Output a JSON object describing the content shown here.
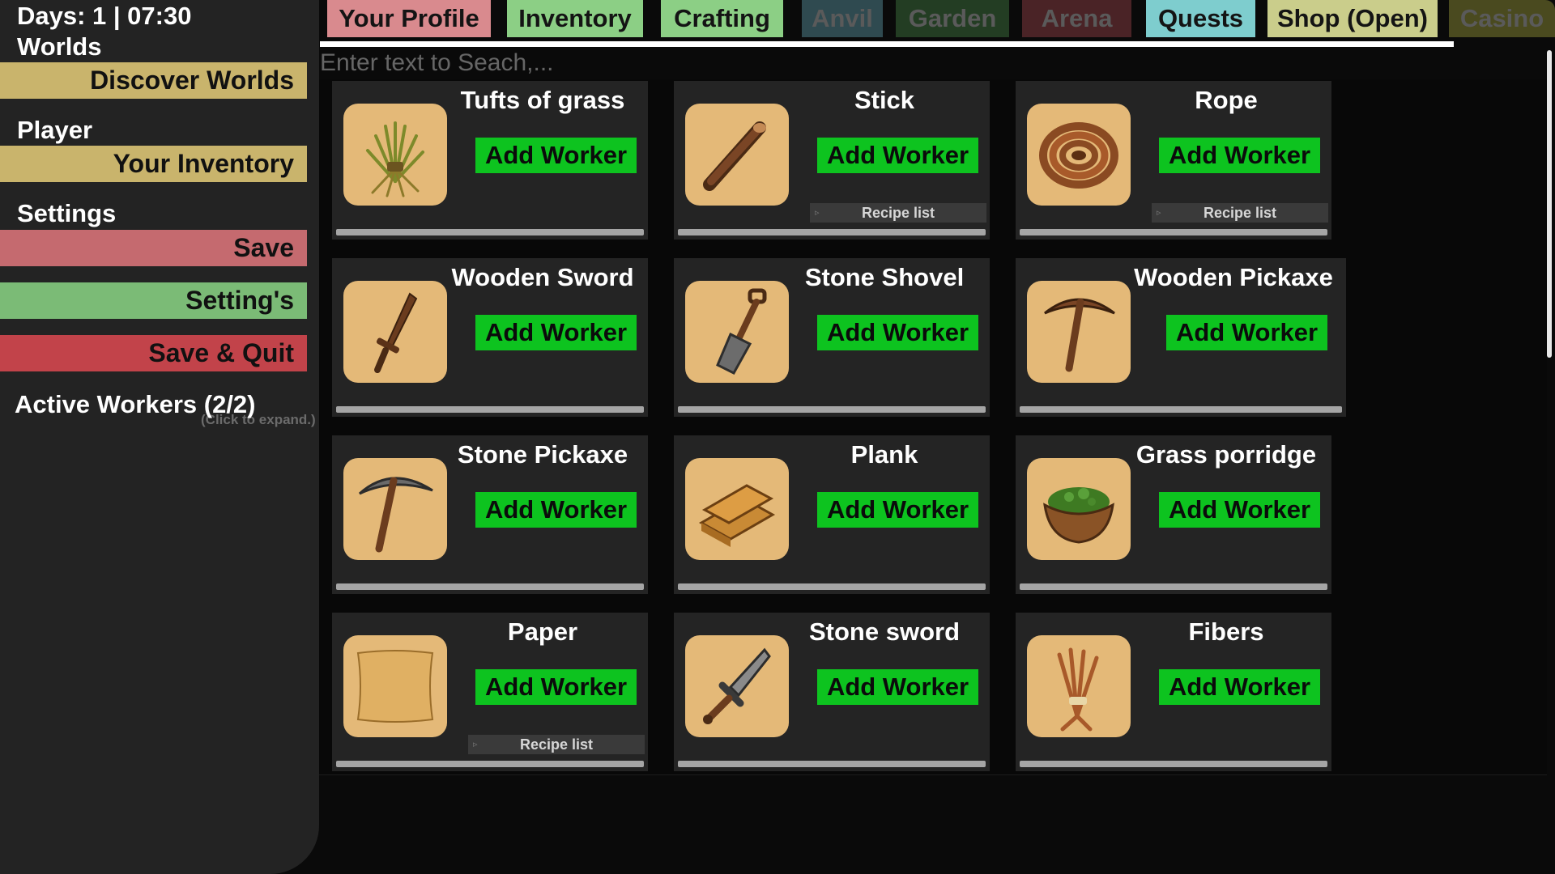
{
  "sidebar": {
    "days_clock": "Days: 1 | 07:30",
    "worlds_label": "Worlds",
    "discover_worlds": "Discover Worlds",
    "player_label": "Player",
    "your_inventory": "Your Inventory",
    "settings_label": "Settings",
    "save": "Save",
    "settings_button": "Setting's",
    "save_quit": "Save & Quit",
    "active_workers": "Active Workers (2/2)",
    "click_hint": "(Click to expand.)"
  },
  "tabs": [
    {
      "label": "Your Profile",
      "color": "#d98a8e",
      "active": true
    },
    {
      "label": "Inventory",
      "color": "#8ccf85",
      "active": true
    },
    {
      "label": "Crafting",
      "color": "#8ccf85",
      "active": true
    },
    {
      "label": "Anvil",
      "color": "#2f4a50",
      "active": false
    },
    {
      "label": "Garden",
      "color": "#233d23",
      "active": false
    },
    {
      "label": "Arena",
      "color": "#4a2326",
      "active": false
    },
    {
      "label": "Quests",
      "color": "#7ecdce",
      "active": true
    },
    {
      "label": "Shop (Open)",
      "color": "#cacd8b",
      "active": true
    },
    {
      "label": "Casino",
      "color": "#4a4a1f",
      "active": false
    }
  ],
  "search": {
    "placeholder": "Enter text to Seach,..."
  },
  "colors": {
    "add_worker": "#0dc31f",
    "card_bg": "#242424",
    "icon_bg": "#e4b978",
    "sidebar_gold": "#c9b46c"
  },
  "items": [
    {
      "name": "Tufts of grass",
      "button": "Add Worker",
      "icon": "grass-tuft-icon"
    },
    {
      "name": "Stick",
      "button": "Add Worker",
      "icon": "stick-icon",
      "recipe": "Recipe list"
    },
    {
      "name": "Rope",
      "button": "Add Worker",
      "icon": "rope-icon",
      "recipe": "Recipe list"
    },
    {
      "name": "Wooden Sword",
      "button": "Add Worker",
      "icon": "wooden-sword-icon"
    },
    {
      "name": "Stone Shovel",
      "button": "Add Worker",
      "icon": "shovel-icon"
    },
    {
      "name": "Wooden Pickaxe",
      "button": "Add Worker",
      "icon": "wooden-pickaxe-icon"
    },
    {
      "name": "Stone Pickaxe",
      "button": "Add Worker",
      "icon": "stone-pickaxe-icon"
    },
    {
      "name": "Plank",
      "button": "Add Worker",
      "icon": "plank-icon"
    },
    {
      "name": "Grass porridge",
      "button": "Add Worker",
      "icon": "porridge-bowl-icon"
    },
    {
      "name": "Paper",
      "button": "Add Worker",
      "icon": "paper-icon",
      "recipe": "Recipe list"
    },
    {
      "name": "Stone sword",
      "button": "Add Worker",
      "icon": "stone-sword-icon"
    },
    {
      "name": "Fibers",
      "button": "Add Worker",
      "icon": "fibers-icon"
    }
  ]
}
